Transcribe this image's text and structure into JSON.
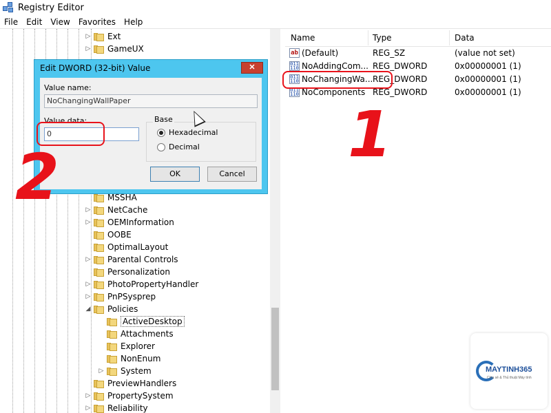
{
  "window": {
    "title": "Registry Editor"
  },
  "menu": [
    "File",
    "Edit",
    "View",
    "Favorites",
    "Help"
  ],
  "tree": {
    "items": [
      {
        "label": "Ext",
        "expander": "▷"
      },
      {
        "label": "GameUX",
        "expander": "▷"
      },
      {
        "label": "MSSHA",
        "expander": ""
      },
      {
        "label": "NetCache",
        "expander": "▷"
      },
      {
        "label": "OEMInformation",
        "expander": "▷"
      },
      {
        "label": "OOBE",
        "expander": ""
      },
      {
        "label": "OptimalLayout",
        "expander": ""
      },
      {
        "label": "Parental Controls",
        "expander": "▷"
      },
      {
        "label": "Personalization",
        "expander": ""
      },
      {
        "label": "PhotoPropertyHandler",
        "expander": "▷"
      },
      {
        "label": "PnPSysprep",
        "expander": "▷"
      },
      {
        "label": "Policies",
        "expander": "◢"
      },
      {
        "label": "ActiveDesktop",
        "expander": ""
      },
      {
        "label": "Attachments",
        "expander": ""
      },
      {
        "label": "Explorer",
        "expander": ""
      },
      {
        "label": "NonEnum",
        "expander": ""
      },
      {
        "label": "System",
        "expander": "▷"
      },
      {
        "label": "PreviewHandlers",
        "expander": ""
      },
      {
        "label": "PropertySystem",
        "expander": "▷"
      },
      {
        "label": "Reliability",
        "expander": "▷"
      }
    ]
  },
  "list": {
    "headers": {
      "name": "Name",
      "type": "Type",
      "data": "Data"
    },
    "rows": [
      {
        "name": "(Default)",
        "type": "REG_SZ",
        "data": "(value not set)",
        "icon": "string-value-icon"
      },
      {
        "name": "NoAddingCom...",
        "type": "REG_DWORD",
        "data": "0x00000001 (1)",
        "icon": "dword-value-icon"
      },
      {
        "name": "NoChangingWa...",
        "type": "REG_DWORD",
        "data": "0x00000001 (1)",
        "icon": "dword-value-icon"
      },
      {
        "name": "NoComponents",
        "type": "REG_DWORD",
        "data": "0x00000001 (1)",
        "icon": "dword-value-icon"
      }
    ]
  },
  "dialog": {
    "title": "Edit DWORD (32-bit) Value",
    "close_label": "✕",
    "value_name_label": "Value name:",
    "value_name": "NoChangingWallPaper",
    "value_data_label": "Value data:",
    "value_data": "0",
    "base_label": "Base",
    "hex_label": "Hexadecimal",
    "dec_label": "Decimal",
    "base_selected": "Hexadecimal",
    "ok_label": "OK",
    "cancel_label": "Cancel"
  },
  "annotations": {
    "step1": "1",
    "step2": "2",
    "color": "#e8121a"
  },
  "watermark": {
    "brand": "MAYTINH365",
    "tagline": "Chia sẻ & Thủ thuật Máy tính"
  }
}
